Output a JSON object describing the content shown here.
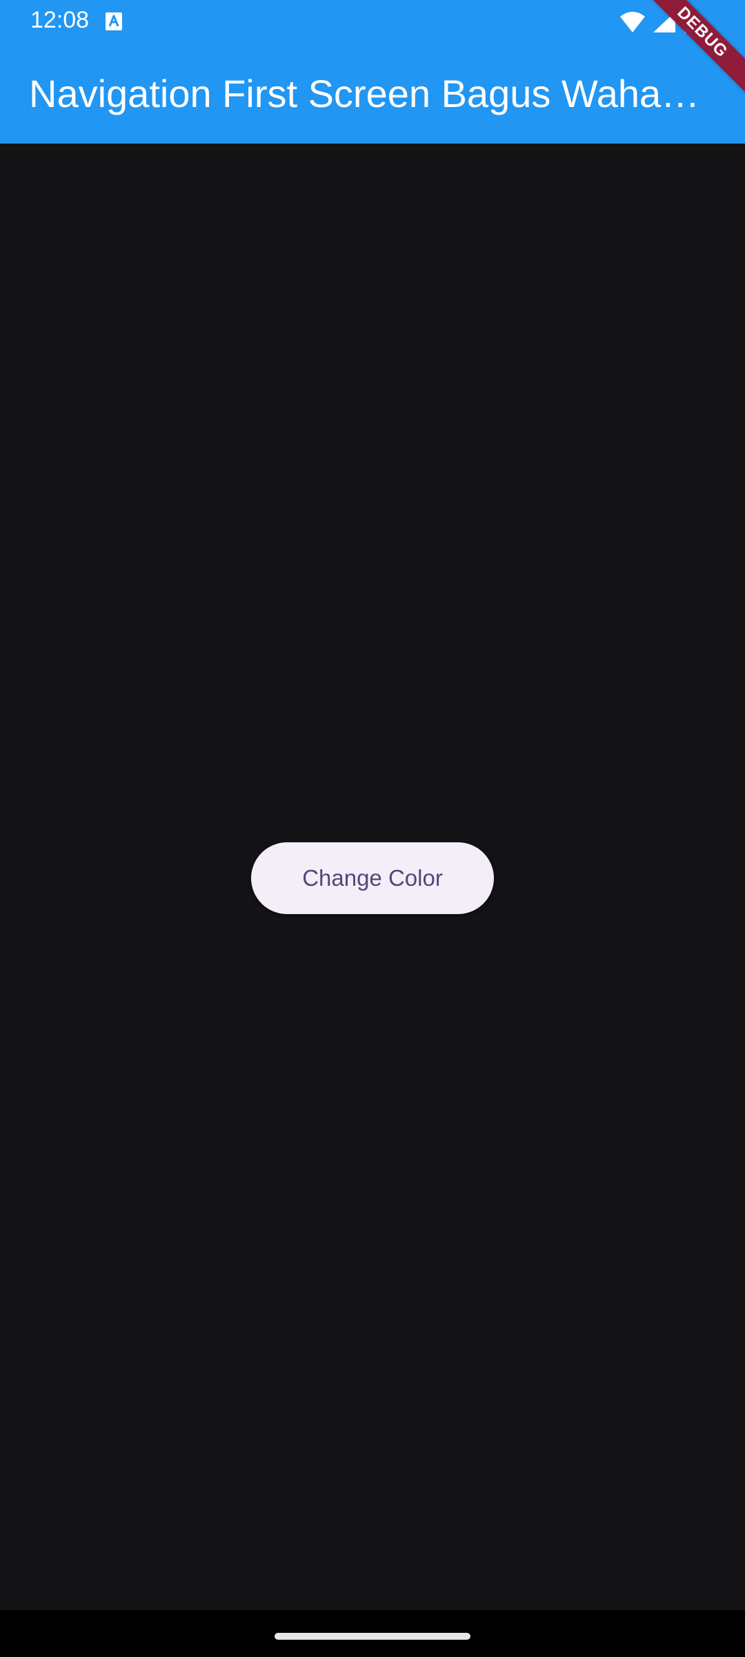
{
  "status_bar": {
    "time": "12:08",
    "icons": [
      "a-notification-icon",
      "wifi-icon",
      "signal-icon",
      "battery-icon"
    ]
  },
  "app_bar": {
    "title": "Navigation First Screen Bagus Waha…",
    "background_color": "#2196F3"
  },
  "debug_banner": {
    "label": "DEBUG"
  },
  "main": {
    "button_label": "Change Color",
    "background_color": "#131316",
    "button_background": "#F3EEF8",
    "button_text_color": "#4F4A78"
  },
  "navigation": {
    "home_indicator": "home-handle"
  }
}
